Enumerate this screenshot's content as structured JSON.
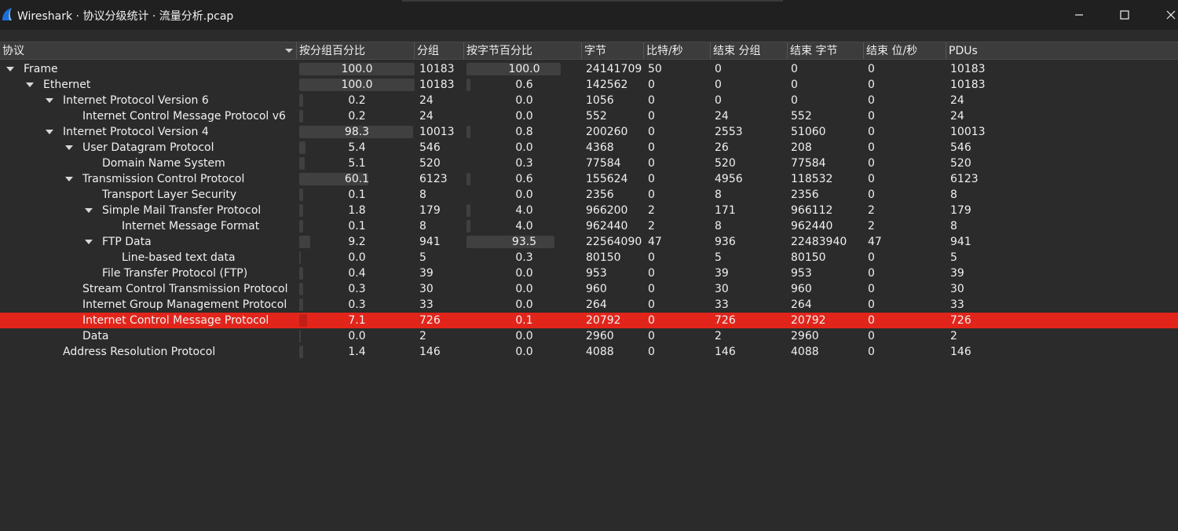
{
  "window": {
    "title": "Wireshark · 协议分级统计 · 流量分析.pcap",
    "minimize_icon": "minimize-icon",
    "maximize_icon": "maximize-icon",
    "close_icon": "close-icon",
    "app_icon": "wireshark-fin-icon",
    "accent": "#1a6fd8",
    "selection_color": "#e1251b"
  },
  "columns": [
    "协议",
    "按分组百分比",
    "分组",
    "按字节百分比",
    "字节",
    "比特/秒",
    "结束 分组",
    "结束 字节",
    "结束 位/秒",
    "PDUs"
  ],
  "rows": [
    {
      "protocol": "Frame",
      "depth": 0,
      "expandable": true,
      "pkt_pct": "100.0",
      "pkt_pct_value": 100.0,
      "packets": "10183",
      "byte_pct": "100.0",
      "byte_pct_value": 100.0,
      "bytes": "24141709",
      "bps": "50",
      "end_packets": "0",
      "end_bytes": "0",
      "end_bps": "0",
      "pdus": "10183"
    },
    {
      "protocol": "Ethernet",
      "depth": 1,
      "expandable": true,
      "pkt_pct": "100.0",
      "pkt_pct_value": 100.0,
      "packets": "10183",
      "byte_pct": "0.6",
      "byte_pct_value": 0.6,
      "bytes": "142562",
      "bps": "0",
      "end_packets": "0",
      "end_bytes": "0",
      "end_bps": "0",
      "pdus": "10183"
    },
    {
      "protocol": "Internet Protocol Version 6",
      "depth": 2,
      "expandable": true,
      "pkt_pct": "0.2",
      "pkt_pct_value": 0.2,
      "packets": "24",
      "byte_pct": "0.0",
      "byte_pct_value": 0.0,
      "bytes": "1056",
      "bps": "0",
      "end_packets": "0",
      "end_bytes": "0",
      "end_bps": "0",
      "pdus": "24"
    },
    {
      "protocol": "Internet Control Message Protocol v6",
      "depth": 3,
      "expandable": false,
      "pkt_pct": "0.2",
      "pkt_pct_value": 0.2,
      "packets": "24",
      "byte_pct": "0.0",
      "byte_pct_value": 0.0,
      "bytes": "552",
      "bps": "0",
      "end_packets": "24",
      "end_bytes": "552",
      "end_bps": "0",
      "pdus": "24"
    },
    {
      "protocol": "Internet Protocol Version 4",
      "depth": 2,
      "expandable": true,
      "pkt_pct": "98.3",
      "pkt_pct_value": 98.3,
      "packets": "10013",
      "byte_pct": "0.8",
      "byte_pct_value": 0.8,
      "bytes": "200260",
      "bps": "0",
      "end_packets": "2553",
      "end_bytes": "51060",
      "end_bps": "0",
      "pdus": "10013"
    },
    {
      "protocol": "User Datagram Protocol",
      "depth": 3,
      "expandable": true,
      "pkt_pct": "5.4",
      "pkt_pct_value": 5.4,
      "packets": "546",
      "byte_pct": "0.0",
      "byte_pct_value": 0.0,
      "bytes": "4368",
      "bps": "0",
      "end_packets": "26",
      "end_bytes": "208",
      "end_bps": "0",
      "pdus": "546"
    },
    {
      "protocol": "Domain Name System",
      "depth": 4,
      "expandable": false,
      "pkt_pct": "5.1",
      "pkt_pct_value": 5.1,
      "packets": "520",
      "byte_pct": "0.3",
      "byte_pct_value": 0.3,
      "bytes": "77584",
      "bps": "0",
      "end_packets": "520",
      "end_bytes": "77584",
      "end_bps": "0",
      "pdus": "520"
    },
    {
      "protocol": "Transmission Control Protocol",
      "depth": 3,
      "expandable": true,
      "pkt_pct": "60.1",
      "pkt_pct_value": 60.1,
      "packets": "6123",
      "byte_pct": "0.6",
      "byte_pct_value": 0.6,
      "bytes": "155624",
      "bps": "0",
      "end_packets": "4956",
      "end_bytes": "118532",
      "end_bps": "0",
      "pdus": "6123"
    },
    {
      "protocol": "Transport Layer Security",
      "depth": 4,
      "expandable": false,
      "pkt_pct": "0.1",
      "pkt_pct_value": 0.1,
      "packets": "8",
      "byte_pct": "0.0",
      "byte_pct_value": 0.0,
      "bytes": "2356",
      "bps": "0",
      "end_packets": "8",
      "end_bytes": "2356",
      "end_bps": "0",
      "pdus": "8"
    },
    {
      "protocol": "Simple Mail Transfer Protocol",
      "depth": 4,
      "expandable": true,
      "pkt_pct": "1.8",
      "pkt_pct_value": 1.8,
      "packets": "179",
      "byte_pct": "4.0",
      "byte_pct_value": 4.0,
      "bytes": "966200",
      "bps": "2",
      "end_packets": "171",
      "end_bytes": "966112",
      "end_bps": "2",
      "pdus": "179"
    },
    {
      "protocol": "Internet Message Format",
      "depth": 5,
      "expandable": false,
      "pkt_pct": "0.1",
      "pkt_pct_value": 0.1,
      "packets": "8",
      "byte_pct": "4.0",
      "byte_pct_value": 4.0,
      "bytes": "962440",
      "bps": "2",
      "end_packets": "8",
      "end_bytes": "962440",
      "end_bps": "2",
      "pdus": "8"
    },
    {
      "protocol": "FTP Data",
      "depth": 4,
      "expandable": true,
      "pkt_pct": "9.2",
      "pkt_pct_value": 9.2,
      "packets": "941",
      "byte_pct": "93.5",
      "byte_pct_value": 93.5,
      "bytes": "22564090",
      "bps": "47",
      "end_packets": "936",
      "end_bytes": "22483940",
      "end_bps": "47",
      "pdus": "941"
    },
    {
      "protocol": "Line-based text data",
      "depth": 5,
      "expandable": false,
      "pkt_pct": "0.0",
      "pkt_pct_value": 0.0,
      "packets": "5",
      "byte_pct": "0.3",
      "byte_pct_value": 0.3,
      "bytes": "80150",
      "bps": "0",
      "end_packets": "5",
      "end_bytes": "80150",
      "end_bps": "0",
      "pdus": "5"
    },
    {
      "protocol": "File Transfer Protocol (FTP)",
      "depth": 4,
      "expandable": false,
      "pkt_pct": "0.4",
      "pkt_pct_value": 0.4,
      "packets": "39",
      "byte_pct": "0.0",
      "byte_pct_value": 0.0,
      "bytes": "953",
      "bps": "0",
      "end_packets": "39",
      "end_bytes": "953",
      "end_bps": "0",
      "pdus": "39"
    },
    {
      "protocol": "Stream Control Transmission Protocol",
      "depth": 3,
      "expandable": false,
      "pkt_pct": "0.3",
      "pkt_pct_value": 0.3,
      "packets": "30",
      "byte_pct": "0.0",
      "byte_pct_value": 0.0,
      "bytes": "960",
      "bps": "0",
      "end_packets": "30",
      "end_bytes": "960",
      "end_bps": "0",
      "pdus": "30"
    },
    {
      "protocol": "Internet Group Management Protocol",
      "depth": 3,
      "expandable": false,
      "pkt_pct": "0.3",
      "pkt_pct_value": 0.3,
      "packets": "33",
      "byte_pct": "0.0",
      "byte_pct_value": 0.0,
      "bytes": "264",
      "bps": "0",
      "end_packets": "33",
      "end_bytes": "264",
      "end_bps": "0",
      "pdus": "33"
    },
    {
      "protocol": "Internet Control Message Protocol",
      "depth": 3,
      "expandable": false,
      "selected": true,
      "pkt_pct": "7.1",
      "pkt_pct_value": 7.1,
      "packets": "726",
      "byte_pct": "0.1",
      "byte_pct_value": 0.1,
      "bytes": "20792",
      "bps": "0",
      "end_packets": "726",
      "end_bytes": "20792",
      "end_bps": "0",
      "pdus": "726"
    },
    {
      "protocol": "Data",
      "depth": 3,
      "expandable": false,
      "pkt_pct": "0.0",
      "pkt_pct_value": 0.0,
      "packets": "2",
      "byte_pct": "0.0",
      "byte_pct_value": 0.0,
      "bytes": "2960",
      "bps": "0",
      "end_packets": "2",
      "end_bytes": "2960",
      "end_bps": "0",
      "pdus": "2"
    },
    {
      "protocol": "Address Resolution Protocol",
      "depth": 2,
      "expandable": false,
      "pkt_pct": "1.4",
      "pkt_pct_value": 1.4,
      "packets": "146",
      "byte_pct": "0.0",
      "byte_pct_value": 0.0,
      "bytes": "4088",
      "bps": "0",
      "end_packets": "146",
      "end_bytes": "4088",
      "end_bps": "0",
      "pdus": "146"
    }
  ]
}
